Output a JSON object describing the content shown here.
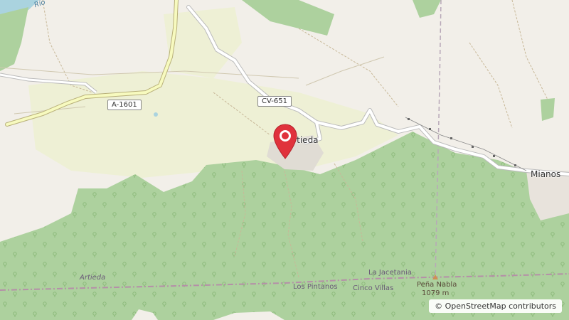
{
  "map": {
    "roads": {
      "a1601": "A-1601",
      "cv651": "CV-651"
    },
    "places": {
      "artieda": "Artieda",
      "mianos": "Mianos"
    },
    "terrain": {
      "artieda_area": "Artieda",
      "la_jacetania": "La Jacetania",
      "los_pintanos": "Los Pintanos",
      "cinco_villas": "Cinco Villas",
      "peak_name": "Peña Nabla",
      "peak_elevation": "1079 m",
      "river": "Río"
    },
    "attribution": {
      "copyright": "©",
      "text": "OpenStreetMap contributors"
    },
    "colors": {
      "forest": "#add19e",
      "farmland": "#eef0d5",
      "background": "#f2efe9",
      "primary_road": "#f7fabf",
      "marker": "#e0323c"
    },
    "marker_icon": "map-pin-icon"
  }
}
